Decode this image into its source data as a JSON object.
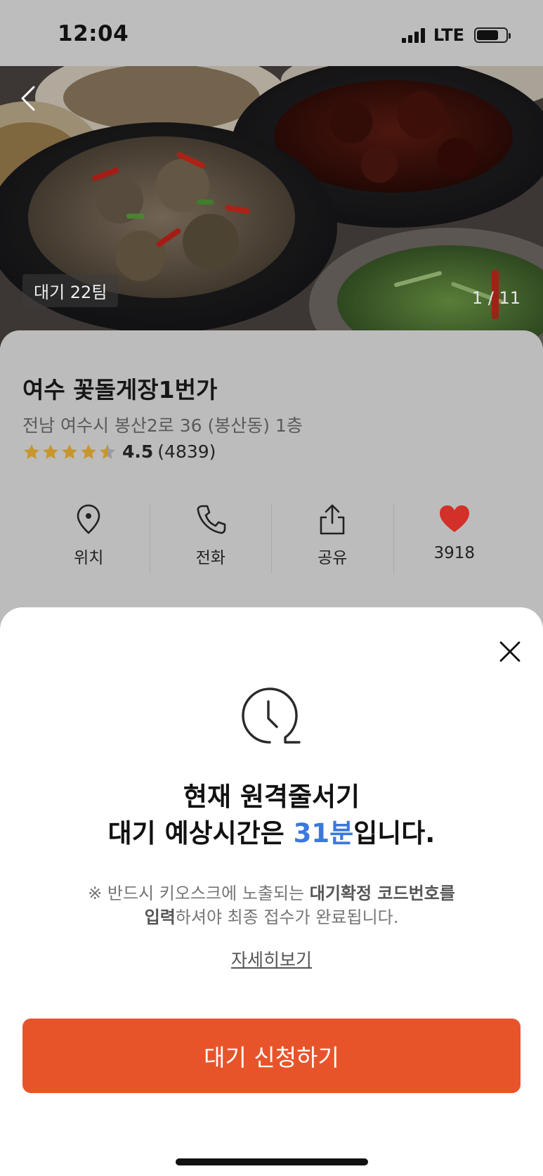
{
  "status_bar": {
    "time": "12:04",
    "network": "LTE",
    "icons": [
      "signal-icon",
      "battery-icon"
    ]
  },
  "hero": {
    "wait_badge": "대기 22팀",
    "photo_counter": "1 / 11",
    "back_icon": "chevron-left-icon"
  },
  "restaurant": {
    "name": "여수 꽃돌게장1번가",
    "address": "전남 여수시 봉산2로 36 (봉산동) 1층",
    "rating": "4.5",
    "rating_fraction": 0.9,
    "review_count": "(4839)",
    "star_color": "#e0a93a"
  },
  "actions": [
    {
      "label": "위치",
      "icon": "location-pin-icon"
    },
    {
      "label": "전화",
      "icon": "phone-icon"
    },
    {
      "label": "공유",
      "icon": "share-icon"
    },
    {
      "label": "3918",
      "icon": "heart-icon"
    }
  ],
  "sheet": {
    "close_icon": "close-icon",
    "clock_icon": "clock-icon",
    "title_line1": "현재 원격줄서기",
    "title_line2_prefix": "대기 예상시간은 ",
    "title_line2_highlight": "31분",
    "title_line2_suffix": "입니다.",
    "notice_prefix": "※ 반드시 키오스크에 노출되는 ",
    "notice_bold1": "대기확정 코드번호를",
    "notice_bold2": "입력",
    "notice_suffix": "하셔야 최종 접수가 완료됩니다.",
    "details_link": "자세히보기",
    "cta_label": "대기 신청하기"
  },
  "colors": {
    "accent_blue": "#3b78de",
    "cta_orange": "#e8542a",
    "heart_red": "#d3302a"
  }
}
